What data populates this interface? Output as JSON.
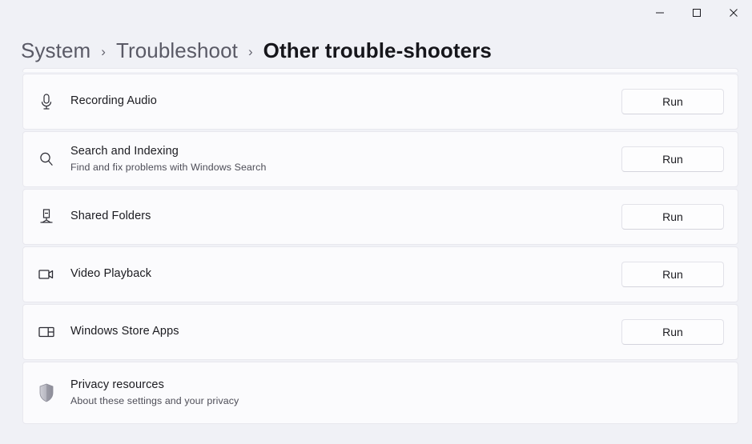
{
  "window": {
    "controls": [
      {
        "name": "minimize-button",
        "icon": "minimize-icon",
        "label": "Minimize"
      },
      {
        "name": "maximize-button",
        "icon": "maximize-icon",
        "label": "Maximize"
      },
      {
        "name": "close-button",
        "icon": "close-icon",
        "label": "Close"
      }
    ]
  },
  "breadcrumb": {
    "items": [
      {
        "label": "System",
        "current": false
      },
      {
        "label": "Troubleshoot",
        "current": false
      },
      {
        "label": "Other trouble-shooters",
        "current": true
      }
    ],
    "separator": "›"
  },
  "troubleshooters": [
    {
      "title": "Recording Audio",
      "subtitle": "",
      "icon": "microphone-icon",
      "action": "Run"
    },
    {
      "title": "Search and Indexing",
      "subtitle": "Find and fix problems with Windows Search",
      "icon": "search-icon",
      "action": "Run"
    },
    {
      "title": "Shared Folders",
      "subtitle": "",
      "icon": "shared-folders-icon",
      "action": "Run"
    },
    {
      "title": "Video Playback",
      "subtitle": "",
      "icon": "video-camera-icon",
      "action": "Run"
    },
    {
      "title": "Windows Store Apps",
      "subtitle": "",
      "icon": "app-window-icon",
      "action": "Run"
    }
  ],
  "privacy": {
    "title": "Privacy resources",
    "subtitle": "About these settings and your privacy",
    "icon": "shield-icon"
  },
  "colors": {
    "page_background": "#f0f1f6",
    "card_background": "#fbfbfd",
    "card_border": "#e8e8ee",
    "primary_text": "#1b1b20",
    "secondary_text": "#4d4d57",
    "breadcrumb_inactive": "#5a5a66"
  }
}
